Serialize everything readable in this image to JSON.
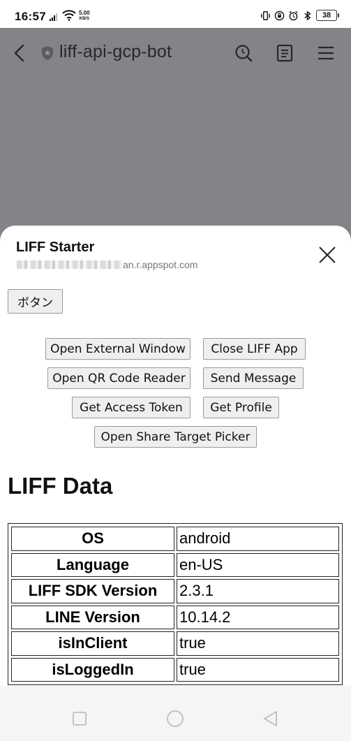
{
  "status_bar": {
    "time": "16:57",
    "net_speed_value": "5.00",
    "net_speed_unit": "KB/S",
    "battery": "38"
  },
  "app_bar": {
    "title": "liff-api-gcp-bot",
    "icons": [
      "back-icon",
      "shield-icon",
      "search-icon",
      "notes-icon",
      "menu-icon"
    ]
  },
  "sheet": {
    "title": "LIFF Starter",
    "url_suffix": "an.r.appspot.com"
  },
  "buttons": {
    "katakana": "ボタン",
    "open_external_window": "Open External Window",
    "close_liff_app": "Close LIFF App",
    "open_qr_code_reader": "Open QR Code Reader",
    "send_message": "Send Message",
    "get_access_token": "Get Access Token",
    "get_profile": "Get Profile",
    "open_share_target_picker": "Open Share Target Picker"
  },
  "liff_data": {
    "heading": "LIFF Data",
    "rows": [
      {
        "key": "OS",
        "value": "android"
      },
      {
        "key": "Language",
        "value": "en-US"
      },
      {
        "key": "LIFF SDK Version",
        "value": "2.3.1"
      },
      {
        "key": "LINE Version",
        "value": "10.14.2"
      },
      {
        "key": "isInClient",
        "value": "true"
      },
      {
        "key": "isLoggedIn",
        "value": "true"
      }
    ]
  },
  "colors": {
    "overlay": "#848388",
    "sheet": "#ffffff",
    "button_bg": "#efefef",
    "button_border": "#9a9a9a"
  }
}
